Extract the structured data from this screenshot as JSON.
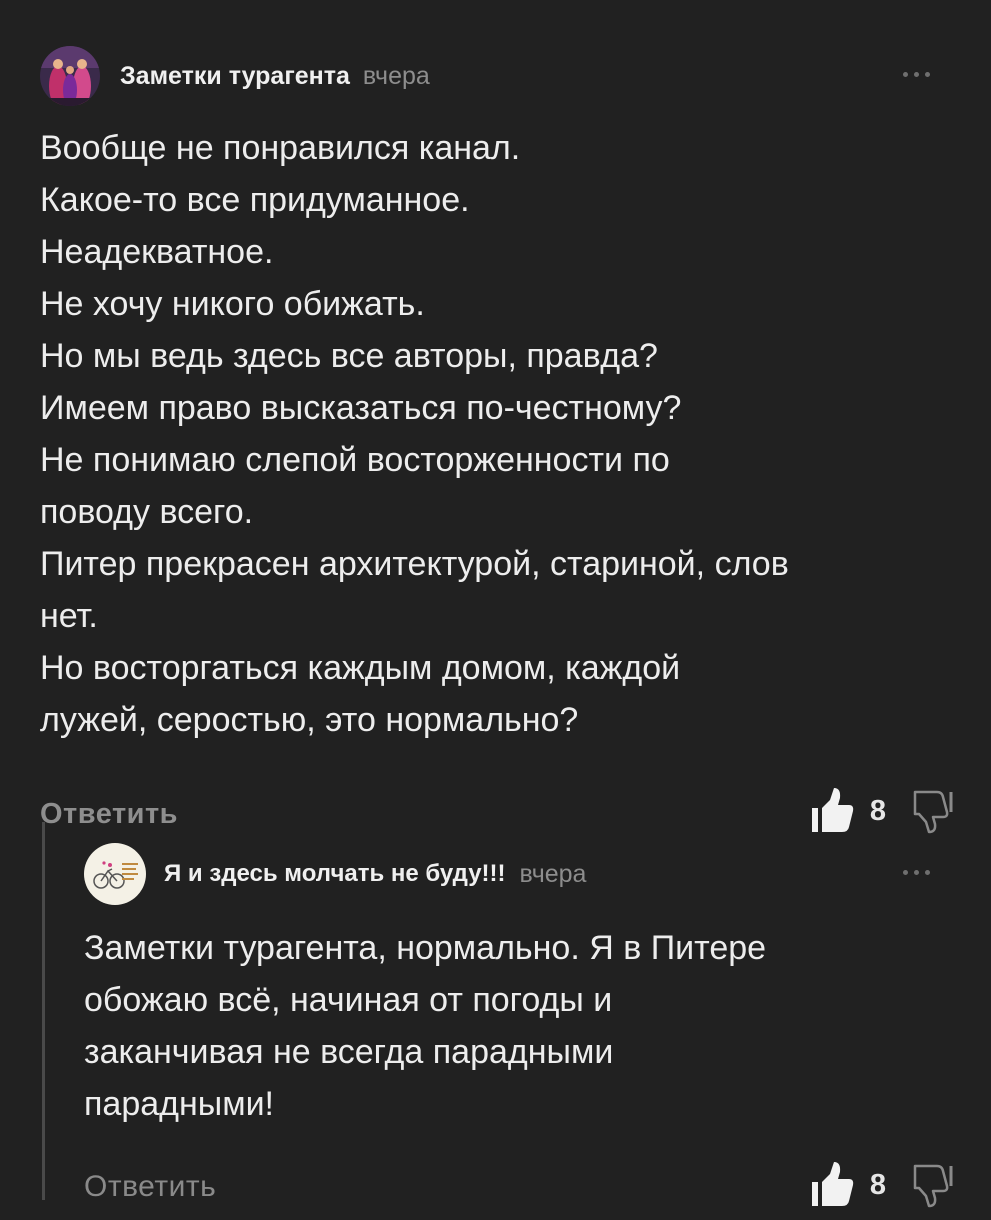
{
  "comments": [
    {
      "author": "Заметки турагента",
      "time": "вчера",
      "lines": [
        "Вообще не понравился канал.",
        "Какое-то все придуманное.",
        "Неадекватное.",
        "Не хочу никого обижать.",
        "Но мы ведь здесь все авторы, правда?",
        "Имеем право высказаться по-честному?",
        "Не понимаю слепой восторженности по",
        "поводу всего.",
        "Питер прекрасен архитектурой, стариной, слов",
        "нет.",
        "Но восторгаться каждым домом, каждой",
        "лужей, серостью, это нормально?"
      ],
      "reply_label": "Ответить",
      "likes": "8"
    },
    {
      "author": "Я и здесь молчать не буду!!!",
      "time": "вчера",
      "lines": [
        "Заметки турагента, нормально. Я в Питере",
        "обожаю всё, начиная от погоды и",
        "заканчивая не всегда парадными",
        "парадными!"
      ],
      "reply_label": "Ответить",
      "likes": "8"
    }
  ],
  "icons": {
    "like": "thumbs-up-icon",
    "dislike": "thumbs-down-icon",
    "more": "more-dots-icon"
  },
  "colors": {
    "background": "#212121",
    "text": "#ededed",
    "muted": "#8d8d8d"
  }
}
